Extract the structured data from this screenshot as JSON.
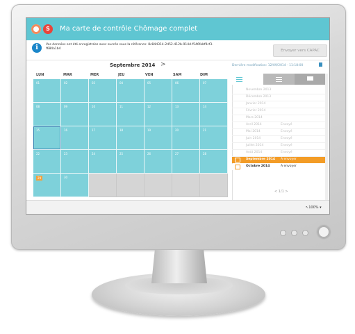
{
  "app": {
    "title": "Ma carte de contrôle Chômage complet",
    "logo_letter": "S"
  },
  "notice": {
    "text": "Vos données ont été enregistrées avec succès sous la référence: 8c84d314-2d52-412b-914d-f546fabf9cf3-f684a1b4",
    "send_button": "Envoyer vers CAPAC"
  },
  "calendar": {
    "month_label": "Septembre 2014",
    "next_arrow": ">",
    "last_modified_label": "Dernière modification:",
    "last_modified_value": "12/09/2014 - 11:18:00",
    "weekdays": [
      "LUN",
      "MAR",
      "MER",
      "JEU",
      "VEN",
      "SAM",
      "DIM"
    ],
    "weeks": [
      [
        "01",
        "02",
        "03",
        "04",
        "05",
        "06",
        "07"
      ],
      [
        "08",
        "09",
        "10",
        "11",
        "12",
        "13",
        "14"
      ],
      [
        "15",
        "16",
        "17",
        "18",
        "19",
        "20",
        "21"
      ],
      [
        "22",
        "23",
        "24",
        "25",
        "26",
        "27",
        "28"
      ],
      [
        "29",
        "30",
        "",
        "",
        "",
        "",
        ""
      ]
    ],
    "selected_day": "15",
    "highlighted_day": "29"
  },
  "panel": {
    "months": [
      {
        "label": "Novembre 2013",
        "status": ""
      },
      {
        "label": "Décembre 2013",
        "status": ""
      },
      {
        "label": "Janvier 2014",
        "status": ""
      },
      {
        "label": "Février 2014",
        "status": ""
      },
      {
        "label": "Mars 2014",
        "status": ""
      },
      {
        "label": "Avril 2014",
        "status": "Envoyé"
      },
      {
        "label": "Mai 2014",
        "status": "Envoyé"
      },
      {
        "label": "Juin 2014",
        "status": "Envoyé"
      },
      {
        "label": "Juillet 2014",
        "status": "Envoyé"
      },
      {
        "label": "Août 2014",
        "status": "Envoyé"
      }
    ],
    "current": {
      "label": "Septembre 2014",
      "status": "A envoyer"
    },
    "next": {
      "label": "Octobre 2014",
      "status": "A envoyer"
    },
    "pager": "< 1/1 >"
  },
  "footer": {
    "zoom": "100%"
  },
  "colors": {
    "header": "#5fc6d2",
    "day_cell": "#7ed1da",
    "accent_orange": "#f39c27",
    "info_blue": "#1b86c9"
  }
}
